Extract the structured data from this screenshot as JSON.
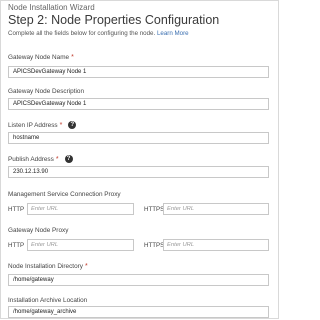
{
  "wizard": {
    "title": "Node Installation Wizard",
    "step_title": "Step 2:  Node Properties Configuration",
    "subtitle": "Complete all the fields below for configuring the node.",
    "learn_more": "Learn More"
  },
  "fields": {
    "gateway_node_name": {
      "label": "Gateway Node Name",
      "required": "*",
      "value": "APICSDevGateway Node 1"
    },
    "gateway_node_description": {
      "label": "Gateway Node Description",
      "value": "APICSDevGateway Node 1"
    },
    "listen_ip": {
      "label": "Listen IP Address",
      "required": "*",
      "value": "hostname"
    },
    "publish_address": {
      "label": "Publish Address",
      "required": "*",
      "value": "230.12.13.90"
    },
    "mgmt_proxy": {
      "label": "Management Service Connection Proxy",
      "http_label": "HTTP",
      "http_placeholder": "Enter URL",
      "https_label": "HTTPS",
      "https_placeholder": "Enter URL"
    },
    "gateway_proxy": {
      "label": "Gateway Node Proxy",
      "http_label": "HTTP",
      "http_placeholder": "Enter URL",
      "https_label": "HTTPS",
      "https_placeholder": "Enter URL"
    },
    "install_dir": {
      "label": "Node Installation Directory",
      "required": "*",
      "value": "/home/gateway"
    },
    "archive_location": {
      "label": "Installation Archive Location",
      "value": "/home/gateway_archive"
    }
  },
  "icons": {
    "help": "help-circle-icon"
  }
}
